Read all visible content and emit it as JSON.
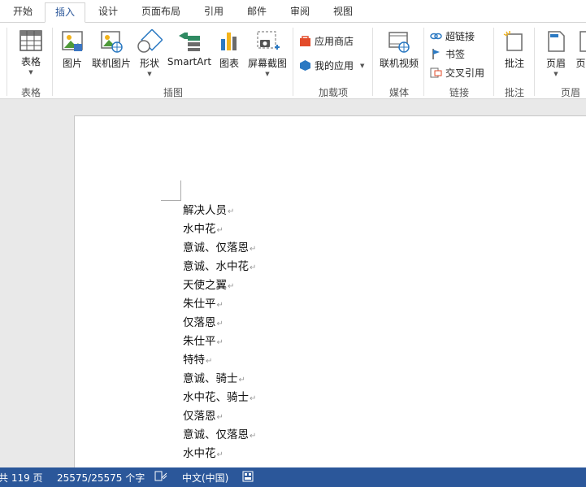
{
  "tabs": [
    {
      "label": "开始"
    },
    {
      "label": "插入"
    },
    {
      "label": "设计"
    },
    {
      "label": "页面布局"
    },
    {
      "label": "引用"
    },
    {
      "label": "邮件"
    },
    {
      "label": "审阅"
    },
    {
      "label": "视图"
    }
  ],
  "ribbon": {
    "table_btn": "表格",
    "picture_btn": "图片",
    "online_picture_btn": "联机图片",
    "shapes_btn": "形状",
    "smartart_btn": "SmartArt",
    "chart_btn": "图表",
    "screenshot_btn": "屏幕截图",
    "store_btn": "应用商店",
    "myapps_btn": "我的应用",
    "online_video_btn": "联机视频",
    "hyperlink_btn": "超链接",
    "bookmark_btn": "书签",
    "crossref_btn": "交叉引用",
    "comment_btn": "批注",
    "header_btn": "页眉",
    "footer_btn_partial": "页",
    "groups": {
      "tables": "表格",
      "illustrations": "插图",
      "addins": "加载项",
      "media": "媒体",
      "links": "链接",
      "comments": "批注",
      "header_footer": "页眉"
    }
  },
  "document": {
    "lines": [
      "解决人员",
      "水中花",
      "意诚、仅落恩",
      "意诚、水中花",
      "天使之翼",
      "朱仕平",
      "仅落恩",
      "朱仕平",
      "特特",
      "意诚、骑士",
      "水中花、骑士",
      "仅落恩",
      "意诚、仅落恩",
      "水中花"
    ],
    "paragraph_mark": "↵"
  },
  "status": {
    "pages": "共 119 页",
    "words": "25575/25575 个字",
    "language": "中文(中国)"
  },
  "colors": {
    "accent": "#2b579a",
    "ribbon_bg": "#ffffff",
    "canvas_bg": "#e9e9e9"
  }
}
